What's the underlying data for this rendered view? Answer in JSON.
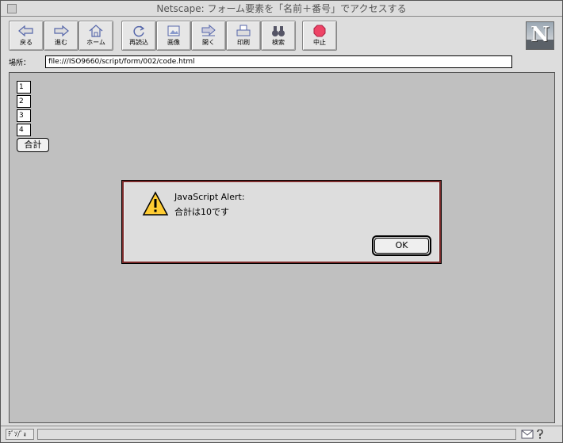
{
  "window": {
    "title": "Netscape: フォーム要素を「名前＋番号」でアクセスする"
  },
  "toolbar": {
    "back": "戻る",
    "forward": "進む",
    "home": "ホーム",
    "reload": "再読込",
    "images": "画像",
    "open": "開く",
    "print": "印刷",
    "find": "検索",
    "stop": "中止"
  },
  "logo": {
    "letter": "N"
  },
  "location": {
    "label": "場所：",
    "url": "file:///ISO9660/script/form/002/code.html"
  },
  "form": {
    "fields": [
      "1",
      "2",
      "3",
      "4"
    ],
    "sum_button": "合計"
  },
  "alert": {
    "title": "JavaScript Alert:",
    "message": "合計は10です",
    "ok_button": "OK"
  },
  "status": {
    "security_label": "ﾃﾞｿ/ﾞｮ"
  }
}
